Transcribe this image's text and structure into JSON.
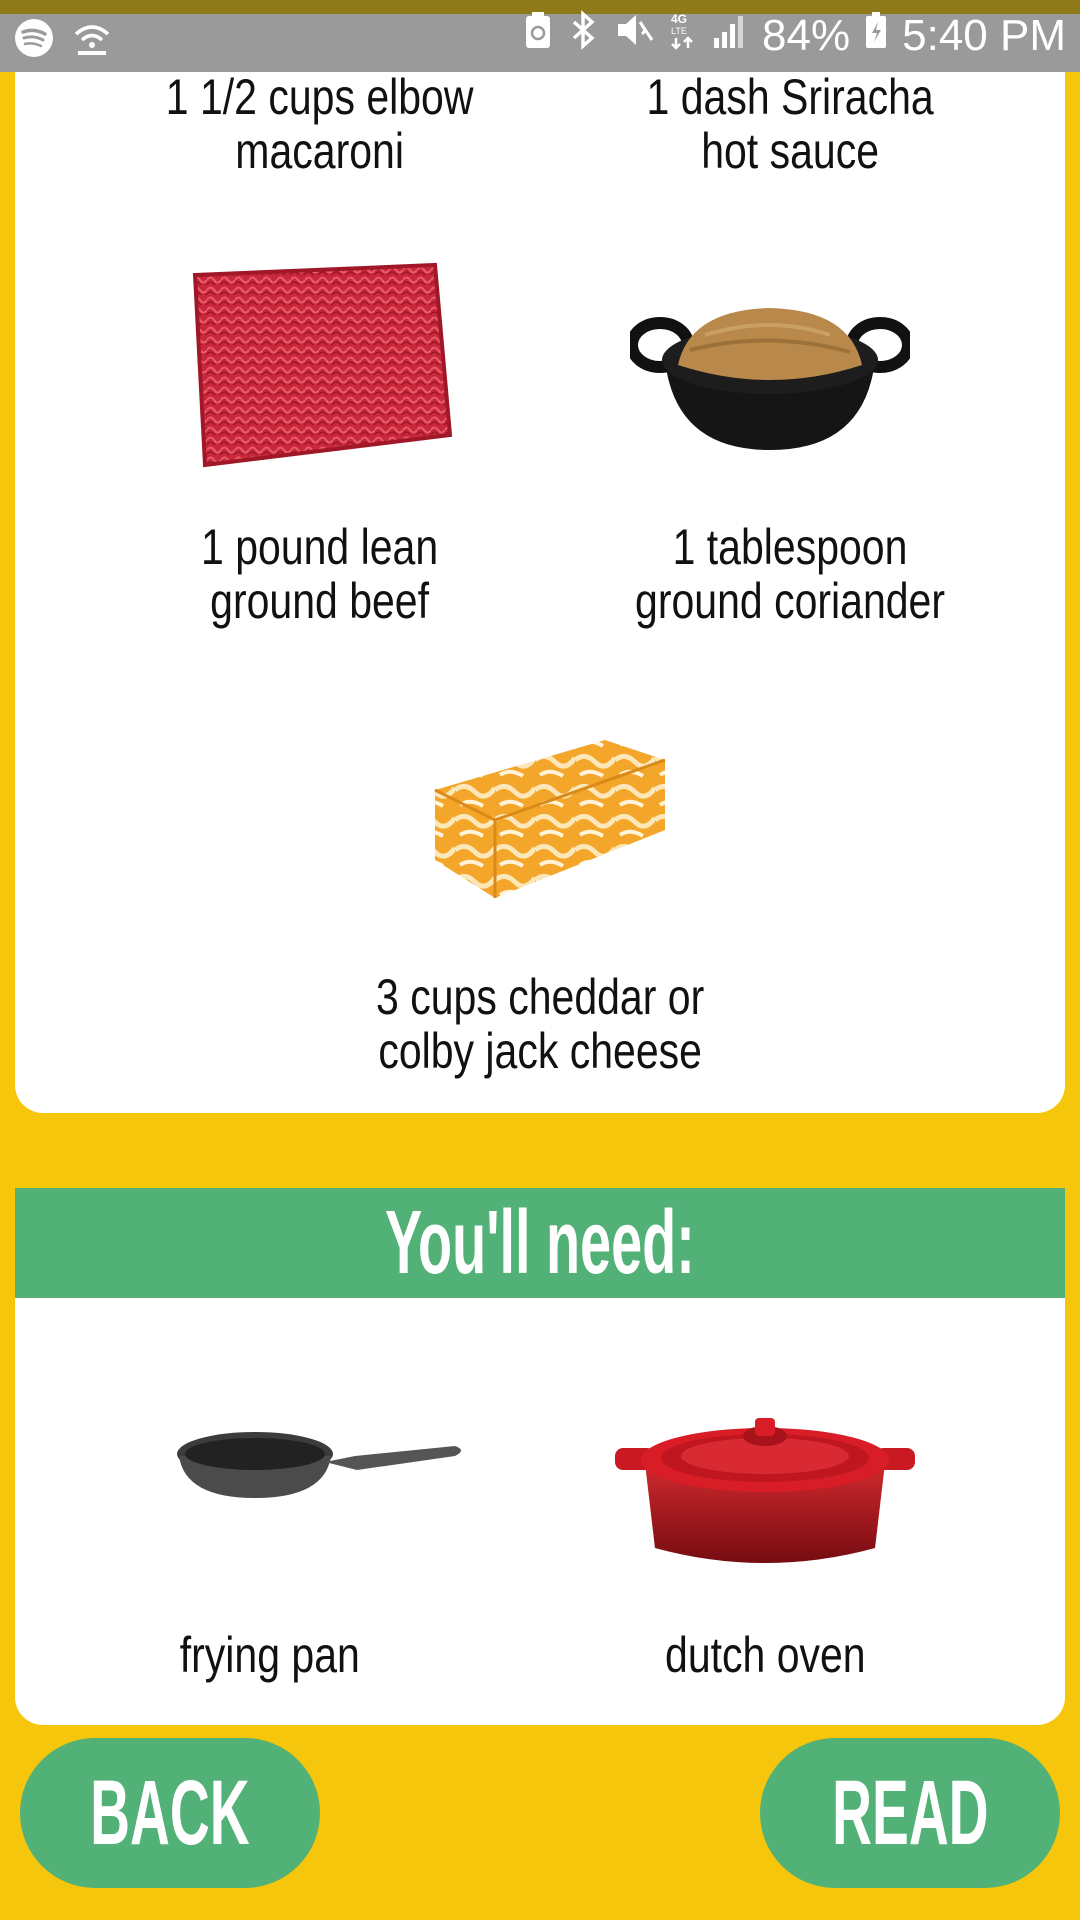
{
  "status_bar": {
    "battery": "84%",
    "time": "5:40 PM",
    "network": "4G LTE",
    "left_icons": [
      "spotify-icon",
      "wifi-hotspot-icon"
    ],
    "right_icons": [
      "recycle-icon",
      "bluetooth-icon",
      "mute-icon",
      "lte-icon",
      "signal-icon",
      "battery-charging-icon"
    ]
  },
  "ingredients": {
    "items": [
      {
        "label": "1 1/2 cups elbow\nmacaroni"
      },
      {
        "label": "1 dash Sriracha\nhot sauce"
      },
      {
        "label": "1 pound lean\nground beef",
        "image": "ground-beef"
      },
      {
        "label": "1 tablespoon\nground coriander",
        "image": "coriander-bowl"
      },
      {
        "label": "3 cups cheddar or\ncolby jack cheese",
        "image": "cheese-block"
      }
    ]
  },
  "tools": {
    "header": "You'll need:",
    "items": [
      {
        "label": "frying pan",
        "image": "frying-pan"
      },
      {
        "label": "dutch oven",
        "image": "dutch-oven"
      }
    ]
  },
  "nav": {
    "back": "BACK",
    "read": "READ"
  },
  "colors": {
    "background": "#F6C60C",
    "accent_green": "#51B176",
    "card": "#FFFFFF"
  }
}
